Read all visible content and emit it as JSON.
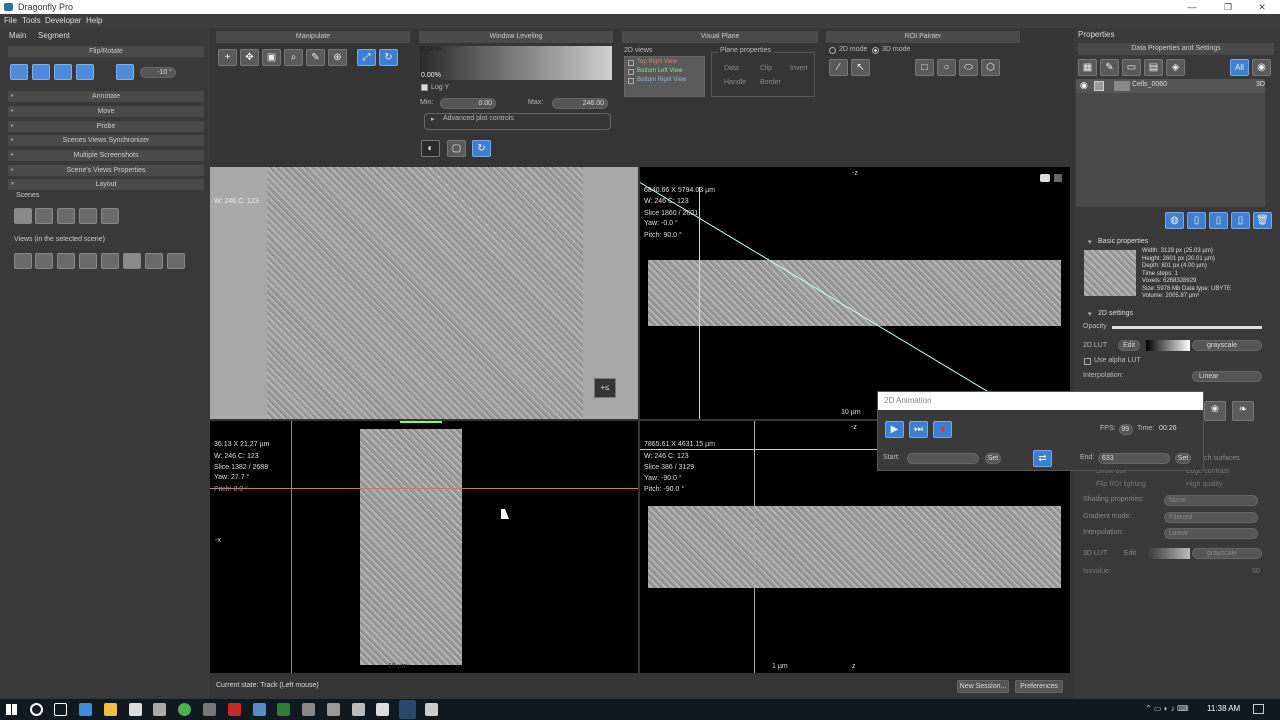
{
  "window": {
    "title": "Dragonfly Pro",
    "minimize": "—",
    "maximize": "❐",
    "close": "✕"
  },
  "menu": [
    "File",
    "Tools",
    "Developer",
    "Help"
  ],
  "left_panel": {
    "tabs": [
      "Main",
      "Segment"
    ],
    "flip_rotate": {
      "title": "Flip/Rotate",
      "angle": "-10 °"
    },
    "sections": [
      "Annotate",
      "Move",
      "Probe",
      "Scenes Views Synchronizer",
      "Multiple Screenshots",
      "Scene's Views Properties",
      "Layout"
    ],
    "scenes_label": "Scenes",
    "views_label": "Views (in the selected scene)"
  },
  "toolbar": {
    "manipulate": "Manipulate",
    "window_leveling": {
      "title": "Window Leveling",
      "top_pct": "0.00%",
      "bottom_pct": "0.00%",
      "log_y": "Log Y",
      "min_label": "Min:",
      "min_value": "0.00",
      "max_label": "Max:",
      "max_value": "246.00",
      "advanced": "Advanced plot controls"
    },
    "visual_plane": {
      "title": "Visual Plane",
      "views_label": "2D views",
      "views": [
        "Top Right View",
        "Bottom Left View",
        "Bottom Right View"
      ],
      "plane_props": "Plane properties",
      "data": "Data",
      "clip": "Clip",
      "invert": "Invert",
      "handle": "Handle",
      "border": "Border"
    },
    "roi_painter": {
      "title": "ROI Painter",
      "mode_2d": "2D mode",
      "mode_3d": "3D mode"
    }
  },
  "views": {
    "top_left": {
      "wl": "W: 246 C: 123"
    },
    "top_right": {
      "coords": "6840.66 X 5794.03 µm",
      "wl": "W: 246 C: 123",
      "slice": "Slice 1860 / 2601",
      "yaw": "Yaw: -0.0 °",
      "pitch": "Pitch: 90.0 °",
      "scale": "10 µm",
      "axis": "-z"
    },
    "bottom_left": {
      "coords": "36.13 X 21.27 µm",
      "wl": "W: 246 C: 123",
      "slice": "Slice 1382 / 2688",
      "yaw": "Yaw: 27.7 °",
      "pitch": "Pitch: 0.0 °",
      "scale": "10 µm",
      "axis": "-x"
    },
    "bottom_right": {
      "coords": "7865.61 X 4631.15 µm",
      "wl": "W: 246 C: 123",
      "slice": "Slice 386 / 3129",
      "yaw": "Yaw: -90.0 °",
      "pitch": "Pitch: -90.0 °",
      "scale": "1 µm",
      "axis_top": "-z",
      "axis_left": "x",
      "axis_bottom": "z"
    }
  },
  "animation": {
    "title": "2D Animation",
    "fps_label": "FPS:",
    "fps": "99",
    "time_label": "Time:",
    "time": "00:26",
    "start_label": "Start:",
    "set": "Set",
    "end_label": "End:",
    "end": "633"
  },
  "right_panel": {
    "properties": "Properties",
    "data_props": "Data Properties and Settings",
    "all_btn": "All",
    "dataset": {
      "name": "Cells_0060",
      "mode": "3D"
    },
    "basic_properties": "Basic properties",
    "basic_lines": [
      "Width: 3129 px (25.03 µm)",
      "Height: 2601 px (20.01 µm)",
      "Depth: 801 px (4.00 µm)",
      "Time steps: 1",
      "Voxels: 6268328929",
      "Size: 5978 Mb  Data type: UBYTE",
      "Volume: 2005.87 µm³"
    ],
    "settings_2d": "2D settings",
    "opacity": "Opacity",
    "lut_2d": "2D LUT",
    "edit": "Edit",
    "lut_value": "grayscale",
    "use_alpha": "Use alpha LUT",
    "interp_label": "Interpolation:",
    "interp_value": "Linear",
    "surfaces": "ch surfaces",
    "show_box": "Show box",
    "edge_contrast": "Edge contrast",
    "flip_roi": "Flip ROI lighting",
    "high_quality": "High quality",
    "shading_label": "Shading properties:",
    "shading_value": "None",
    "gradient_label": "Gradient mode:",
    "gradient_value": "Filtered",
    "interp3d_label": "Interpolation:",
    "interp3d_value": "Linear",
    "lut_3d": "3D LUT",
    "lut3d_value": "grayscale",
    "isovalue": "Isovalue:",
    "iso_num": "50"
  },
  "status": {
    "state": "Current state: Track (Left mouse)",
    "new_session": "New Session...",
    "preferences": "Preferences"
  },
  "taskbar": {
    "time": "11:38 AM"
  }
}
